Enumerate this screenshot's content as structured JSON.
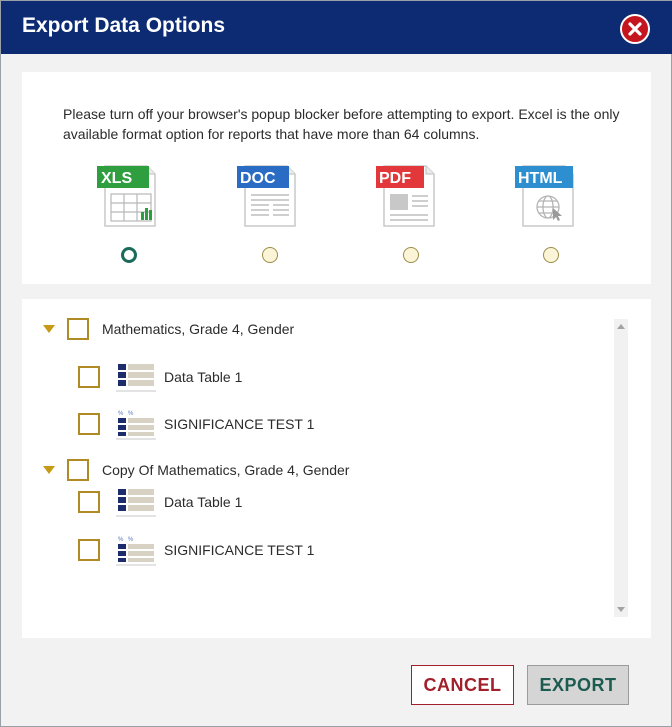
{
  "dialog": {
    "title": "Export Data Options",
    "close_icon": "close-x-icon",
    "notice": "Please turn off your browser's popup blocker before attempting to export. Excel is the only available format option for reports that have more than 64 columns."
  },
  "formats": [
    {
      "label": "XLS",
      "color": "#2f9e3f",
      "icon": "spreadsheet-icon",
      "selected": true
    },
    {
      "label": "DOC",
      "color": "#2a6cc4",
      "icon": "document-icon",
      "selected": false
    },
    {
      "label": "PDF",
      "color": "#e2383b",
      "icon": "pdf-icon",
      "selected": false
    },
    {
      "label": "HTML",
      "color": "#2d8fd0",
      "icon": "globe-page-icon",
      "selected": false
    }
  ],
  "tree": {
    "groups": [
      {
        "label": "Mathematics, Grade 4, Gender",
        "items": [
          {
            "label": "Data Table 1",
            "icon": "data-table-icon"
          },
          {
            "label": "SIGNIFICANCE TEST 1",
            "icon": "significance-test-icon"
          }
        ]
      },
      {
        "label": "Copy Of Mathematics, Grade 4, Gender",
        "items": [
          {
            "label": "Data Table 1",
            "icon": "data-table-icon"
          },
          {
            "label": "SIGNIFICANCE TEST 1",
            "icon": "significance-test-icon"
          }
        ]
      }
    ]
  },
  "buttons": {
    "cancel": "CANCEL",
    "export": "EXPORT"
  },
  "colors": {
    "titlebar": "#0d2b73",
    "close": "#c5161f",
    "checkbox_border": "#b08a24",
    "caret": "#c79a16",
    "cancel_text": "#a1202b",
    "export_text": "#1c5b50"
  }
}
